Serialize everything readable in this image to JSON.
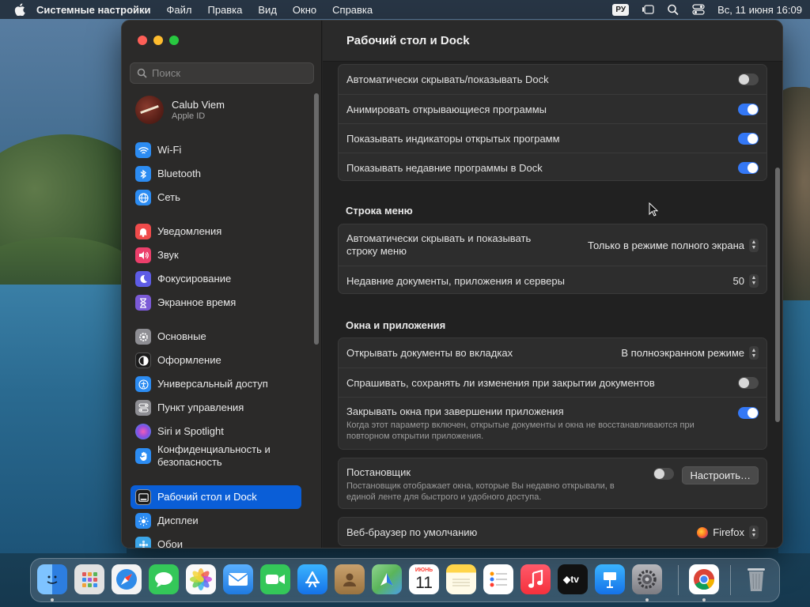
{
  "menubar": {
    "app_name": "Системные настройки",
    "items": [
      "Файл",
      "Правка",
      "Вид",
      "Окно",
      "Справка"
    ],
    "input_lang": "РУ",
    "datetime": "Вс, 11 июня  16:09"
  },
  "window": {
    "title": "Рабочий стол и Dock"
  },
  "sidebar": {
    "search_placeholder": "Поиск",
    "account": {
      "name": "Calub Viem",
      "sub": "Apple ID"
    },
    "items": [
      {
        "label": "Wi-Fi",
        "icon": "wifi-icon",
        "color": "#2c8cf2"
      },
      {
        "label": "Bluetooth",
        "icon": "bluetooth-icon",
        "color": "#2c8cf2"
      },
      {
        "label": "Сеть",
        "icon": "globe-icon",
        "color": "#2c8cf2"
      },
      {
        "label": "Уведомления",
        "icon": "bell-icon",
        "color": "#ef4b4b"
      },
      {
        "label": "Звук",
        "icon": "speaker-icon",
        "color": "#ec3f6b"
      },
      {
        "label": "Фокусирование",
        "icon": "moon-icon",
        "color": "#5e5ce6"
      },
      {
        "label": "Экранное время",
        "icon": "hourglass-icon",
        "color": "#7b5ad6"
      },
      {
        "label": "Основные",
        "icon": "gear-icon",
        "color": "#8e8e93"
      },
      {
        "label": "Оформление",
        "icon": "appearance-icon",
        "color": "#1c1c1c"
      },
      {
        "label": "Универсальный доступ",
        "icon": "accessibility-icon",
        "color": "#2c8cf2"
      },
      {
        "label": "Пункт управления",
        "icon": "control-center-icon",
        "color": "#8e8e93"
      },
      {
        "label": "Siri и Spotlight",
        "icon": "siri-icon",
        "color": "#b04cd6"
      },
      {
        "label": "Конфиденциальность и безопасность",
        "icon": "hand-icon",
        "color": "#2c8cf2"
      },
      {
        "label": "Рабочий стол и Dock",
        "icon": "dock-icon",
        "color": "#1c1c1c"
      },
      {
        "label": "Дисплеи",
        "icon": "sun-icon",
        "color": "#2c8cf2"
      },
      {
        "label": "Обои",
        "icon": "wallpaper-icon",
        "color": "#3ba5e8"
      }
    ]
  },
  "content": {
    "dock_group": [
      {
        "label": "Автоматически скрывать/показывать Dock",
        "toggle": false
      },
      {
        "label": "Анимировать открывающиеся программы",
        "toggle": true
      },
      {
        "label": "Показывать индикаторы открытых программ",
        "toggle": true
      },
      {
        "label": "Показывать недавние программы в Dock",
        "toggle": true
      }
    ],
    "menubar_section": "Строка меню",
    "menubar_group": {
      "autohide_label": "Автоматически скрывать и показывать строку меню",
      "autohide_value": "Только в режиме полного экрана",
      "recent_label": "Недавние документы, приложения и серверы",
      "recent_value": "50"
    },
    "windows_section": "Окна и приложения",
    "windows_group": {
      "tabs_label": "Открывать документы во вкладках",
      "tabs_value": "В полноэкранном режиме",
      "ask_label": "Спрашивать, сохранять ли изменения при закрытии документов",
      "ask_toggle": false,
      "close_label": "Закрывать окна при завершении приложения",
      "close_toggle": true,
      "close_desc": "Когда этот параметр включен, открытые документы и окна не восстанавливаются при повторном открытии приложения."
    },
    "stage_group": {
      "label": "Постановщик",
      "desc": "Постановщик отображает окна, которые Вы недавно открывали, в единой ленте для быстрого и удобного доступа.",
      "toggle": false,
      "button": "Настроить…"
    },
    "browser_group": {
      "label": "Веб-браузер по умолчанию",
      "value": "Firefox"
    }
  },
  "dock": {
    "apps": [
      {
        "name": "finder-icon",
        "color": "#3b8ff0",
        "glyph": "☺"
      },
      {
        "name": "launchpad-icon",
        "color": "#d8d8d8",
        "glyph": "⋮"
      },
      {
        "name": "safari-icon",
        "color": "#2f8be8",
        "glyph": "◎"
      },
      {
        "name": "messages-icon",
        "color": "#34c759",
        "glyph": "✉"
      },
      {
        "name": "photos-icon",
        "color": "#f5f5f5",
        "glyph": "✿"
      },
      {
        "name": "mail-icon",
        "color": "#2d8cf0",
        "glyph": "✉"
      },
      {
        "name": "facetime-icon",
        "color": "#34c759",
        "glyph": "▶"
      },
      {
        "name": "app-store-icon",
        "color": "#1f8ef1",
        "glyph": "A"
      },
      {
        "name": "contacts-icon",
        "color": "#b58a55",
        "glyph": "◉"
      },
      {
        "name": "maps-icon",
        "color": "#5ab55a",
        "glyph": "➤"
      },
      {
        "name": "calendar-icon",
        "color": "#ffffff",
        "glyph": "11"
      },
      {
        "name": "notes-icon",
        "color": "#ffd54a",
        "glyph": "≡"
      },
      {
        "name": "reminders-icon",
        "color": "#ffffff",
        "glyph": "☰"
      },
      {
        "name": "music-icon",
        "color": "#fa3c4c",
        "glyph": "♪"
      },
      {
        "name": "tv-icon",
        "color": "#111111",
        "glyph": "tv"
      },
      {
        "name": "keynote-icon",
        "color": "#2a8ff0",
        "glyph": "▭"
      },
      {
        "name": "system-settings-icon",
        "color": "#8e8e93",
        "glyph": "⚙"
      },
      {
        "name": "chrome-icon",
        "color": "#ffffff",
        "glyph": "◉"
      },
      {
        "name": "trash-icon",
        "color": "#9aa3ab",
        "glyph": "🗑"
      }
    ],
    "calendar_month": "ИЮНЬ"
  }
}
